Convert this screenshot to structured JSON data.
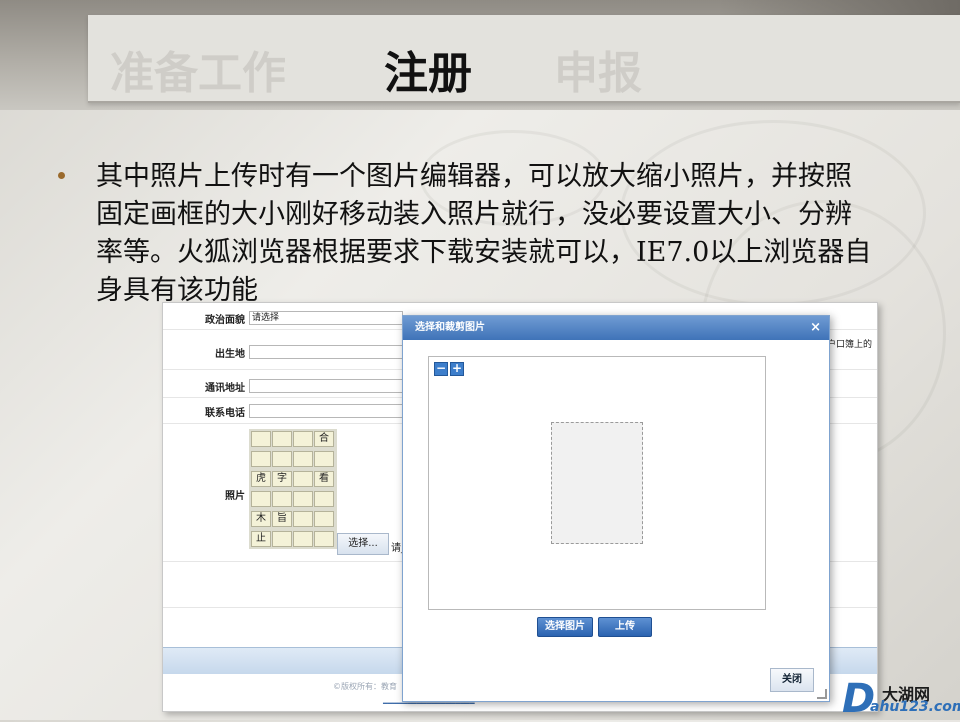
{
  "header": {
    "tabs": [
      {
        "label": "准备工作",
        "active": false
      },
      {
        "label": "注册",
        "active": true
      },
      {
        "label": "申报",
        "active": false
      }
    ]
  },
  "bullet": {
    "text": "其中照片上传时有一个图片编辑器，可以放大缩小照片，并按照固定画框的大小刚好移动装入照片就行，没必要设置大小、分辨率等。火狐浏览器根据要求下载安装就可以，IE7.0以上浏览器自身具有该功能"
  },
  "form": {
    "political_label": "政治面貌",
    "political_value": "请选择",
    "birthplace_label": "出生地",
    "address_label": "通讯地址",
    "phone_label": "联系电话",
    "photo_label": "照片",
    "select_button": "选择...",
    "truncated_hint": "请_",
    "right_fragment": "户口簿上的",
    "footer_copyright": "©版权所有：教育"
  },
  "photo_thumbs": [
    "",
    "",
    "",
    "合",
    "",
    "",
    "",
    "",
    "虎",
    "字",
    "",
    "看",
    "",
    "",
    "",
    "",
    "木",
    "旨",
    "",
    "",
    "止",
    "",
    "",
    ""
  ],
  "dialog": {
    "title": "选择和裁剪图片",
    "close_symbol": "×",
    "zoom_out": "−",
    "zoom_in": "+",
    "select_image_button": "选择图片",
    "upload_button": "上传",
    "close_button": "关闭"
  },
  "watermark": {
    "letter": "D",
    "top": "大湖网",
    "bottom": "ahu123.com"
  },
  "colors": {
    "dialog_title": "#3f73b8",
    "accent_button": "#2b63b0",
    "bullet": "#9a6a2c"
  }
}
